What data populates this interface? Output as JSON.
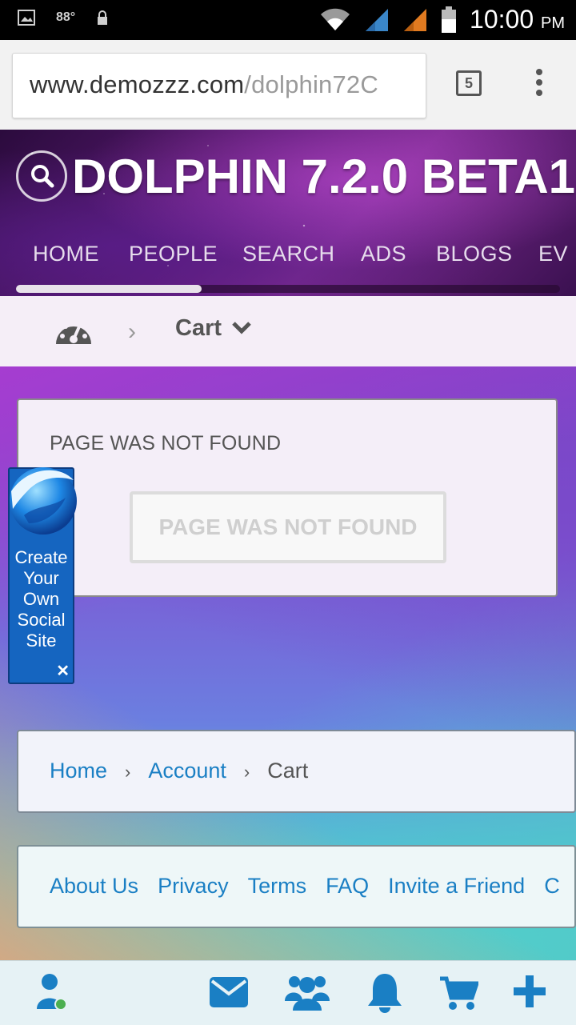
{
  "status_bar": {
    "temperature": "88°",
    "time": "10:00",
    "ampm": "PM"
  },
  "browser": {
    "url_domain": "www.demozzz.com",
    "url_path": "/dolphin72C",
    "tab_count": "5"
  },
  "site": {
    "title": "DOLPHIN 7.2.0 BETA1",
    "nav": [
      "HOME",
      "PEOPLE",
      "SEARCH",
      "ADS",
      "BLOGS",
      "EV"
    ]
  },
  "crumbbar": {
    "current": "Cart"
  },
  "content": {
    "heading": "PAGE WAS NOT FOUND",
    "message": "PAGE WAS NOT FOUND"
  },
  "widget": {
    "lines": [
      "Create",
      "Your",
      "Own",
      "Social",
      "Site"
    ]
  },
  "breadcrumb": {
    "home": "Home",
    "account": "Account",
    "current": "Cart",
    "separator": "›"
  },
  "footer": {
    "links": [
      "About Us",
      "Privacy",
      "Terms",
      "FAQ",
      "Invite a Friend",
      "C"
    ]
  },
  "toolbar": {
    "icons": [
      "user-icon",
      "mail-icon",
      "friends-icon",
      "bell-icon",
      "cart-icon",
      "plus-icon"
    ]
  },
  "colors": {
    "link": "#1a7fc4",
    "toolbar_icon": "#1a7fc4",
    "widget": "#1565c0"
  }
}
